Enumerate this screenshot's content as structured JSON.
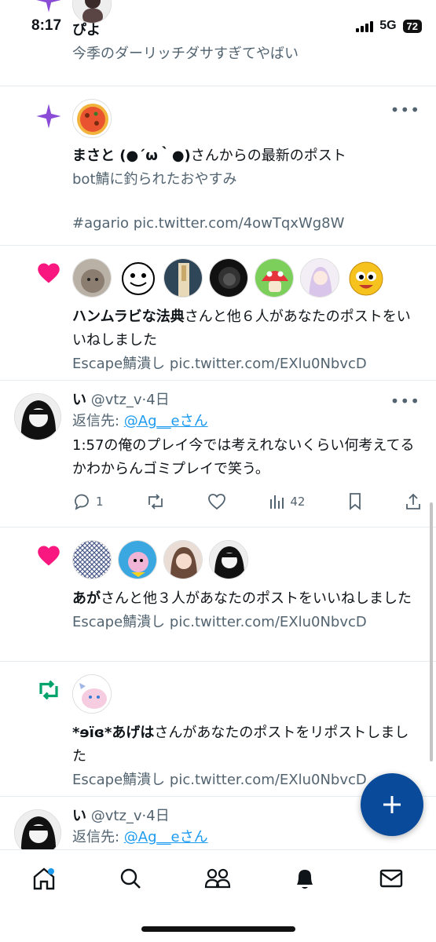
{
  "status": {
    "time": "8:17",
    "network": "5G",
    "battery": "72"
  },
  "notifications": [
    {
      "type": "new_post_partial",
      "name": "ぴよ",
      "text": "今季のダーリッチダサすぎてやばい"
    },
    {
      "type": "new_post",
      "user": "まさと (●´ω｀●)",
      "suffix": "さんからの最新のポスト",
      "line1": "bot鯖に釣られたおやすみ",
      "line2": "#agario pic.twitter.com/4owTqxWg8W"
    },
    {
      "type": "like",
      "user": "ハンムラビな法典",
      "suffix": "さんと他６人があなたのポストをいいねしました",
      "preview": "Escape鯖潰し pic.twitter.com/EXlu0NbvcD"
    },
    {
      "type": "reply",
      "name": "い",
      "handle": "@vtz_v",
      "time": "4日",
      "reply_prefix": "返信先: ",
      "reply_to": "@Ag__eさん",
      "text": "1:57の俺のプレイ今では考えれないくらい何考えてるかわからんゴミプレイで笑う。",
      "replies": "1",
      "views": "42"
    },
    {
      "type": "like",
      "user": "あが",
      "suffix": "さんと他３人があなたのポストをいいねしました",
      "preview": "Escape鯖潰し pic.twitter.com/EXlu0NbvcD"
    },
    {
      "type": "repost",
      "user": "*ɘïɞ*あげは",
      "suffix": "さんがあなたのポストをリポストしました",
      "preview": "Escape鯖潰し pic.twitter.com/EXlu0NbvcD"
    },
    {
      "type": "reply_partial",
      "name": "い",
      "handle": "@vtz_v",
      "time": "4日",
      "reply_prefix": "返信先: ",
      "reply_to": "@Ag__eさん"
    }
  ],
  "colors": {
    "like": "#f91880",
    "repost": "#00a36c",
    "star": "#8a4bd6",
    "fab": "#0a4a9a",
    "link": "#1d9bf0"
  },
  "tabs": [
    "home-icon",
    "search-icon",
    "communities-icon",
    "notifications-icon",
    "messages-icon"
  ]
}
